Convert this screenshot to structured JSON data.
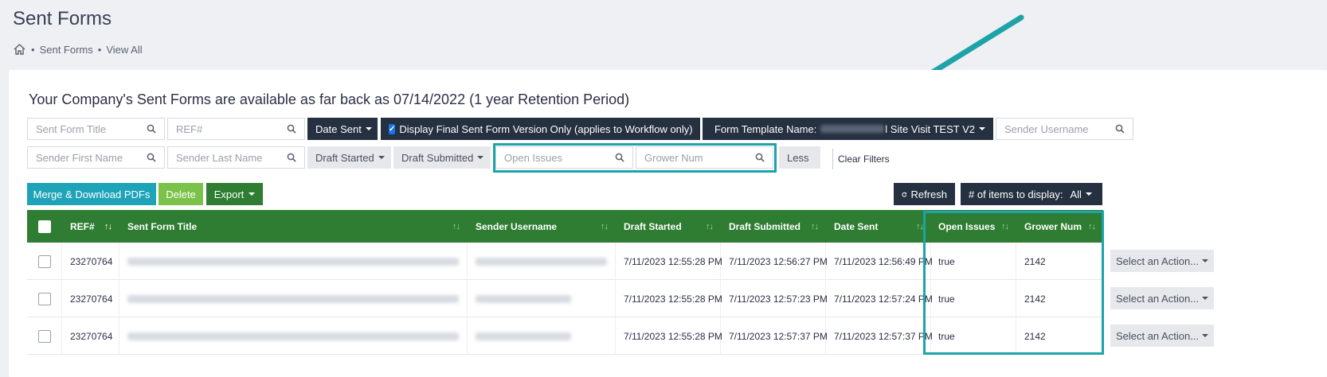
{
  "page": {
    "title": "Sent Forms"
  },
  "breadcrumb": {
    "items": [
      "Sent Forms",
      "View All"
    ],
    "separator": "•"
  },
  "retention_notice": "Your Company's Sent Forms are available as far back as 07/14/2022 (1 year Retention Period)",
  "filters": {
    "sent_form_title_placeholder": "Sent Form Title",
    "ref_placeholder": "REF#",
    "date_sent_label": "Date Sent",
    "final_version_label": "Display Final Sent Form Version Only (applies to Workflow only)",
    "final_version_checked": true,
    "form_template_label": "Form Template Name:",
    "form_template_value_suffix": "l Site Visit TEST V2",
    "sender_username_placeholder": "Sender Username",
    "sender_first_name_placeholder": "Sender First Name",
    "sender_last_name_placeholder": "Sender Last Name",
    "draft_started_label": "Draft Started",
    "draft_submitted_label": "Draft Submitted",
    "open_issues_placeholder": "Open Issues",
    "grower_num_placeholder": "Grower Num",
    "less_label": "Less",
    "clear_filters_label": "Clear Filters"
  },
  "toolbar": {
    "merge_label": "Merge & Download PDFs",
    "delete_label": "Delete",
    "export_label": "Export",
    "refresh_label": "Refresh",
    "items_label": "# of items to display:",
    "items_value": "All"
  },
  "table": {
    "columns": [
      "REF#",
      "Sent Form Title",
      "Sender Username",
      "Draft Started",
      "Draft Submitted",
      "Date Sent",
      "Open Issues",
      "Grower Num"
    ],
    "rows": [
      {
        "ref": "23270764",
        "draft_started": "7/11/2023 12:55:28 PM",
        "draft_submitted": "7/11/2023 12:56:27 PM",
        "date_sent": "7/11/2023 12:56:49 PM",
        "open_issues": "true",
        "grower_num": "2142",
        "action": "Select an Action..."
      },
      {
        "ref": "23270764",
        "draft_started": "7/11/2023 12:55:28 PM",
        "draft_submitted": "7/11/2023 12:57:23 PM",
        "date_sent": "7/11/2023 12:57:24 PM",
        "open_issues": "true",
        "grower_num": "2142",
        "action": "Select an Action..."
      },
      {
        "ref": "23270764",
        "draft_started": "7/11/2023 12:55:28 PM",
        "draft_submitted": "7/11/2023 12:57:37 PM",
        "date_sent": "7/11/2023 12:57:37 PM",
        "open_issues": "true",
        "grower_num": "2142",
        "action": "Select an Action..."
      }
    ]
  },
  "colors": {
    "header_green": "#2e7d32",
    "highlight_teal": "#1ea3a8",
    "dark_button": "#253040"
  }
}
